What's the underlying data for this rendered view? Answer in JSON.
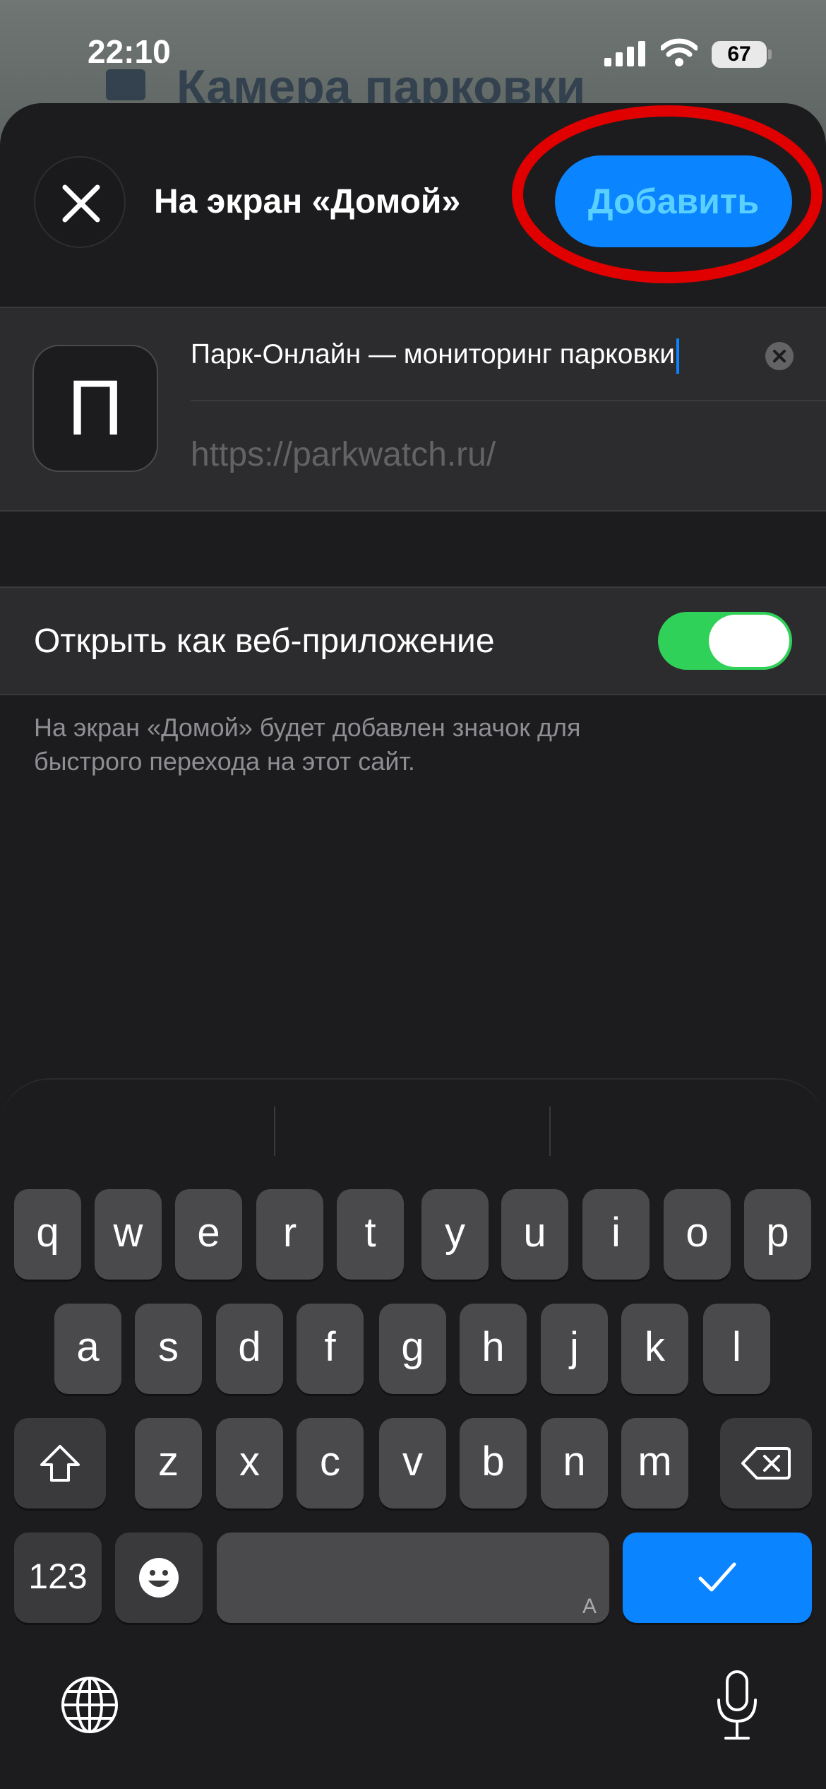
{
  "status_bar": {
    "time": "22:10",
    "battery": "67"
  },
  "background_page": {
    "title": "Камера парковки"
  },
  "header": {
    "title": "На экран «Домой»",
    "add_label": "Добавить"
  },
  "site": {
    "icon_letter": "П",
    "name_value": "Парк-Онлайн — мониторинг парковки",
    "url": "https://parkwatch.ru/"
  },
  "web_app": {
    "label": "Открыть как веб-приложение",
    "enabled": true,
    "hint": "На экран «Домой» будет добавлен значок для быстрого перехода на этот сайт."
  },
  "keyboard": {
    "row1": [
      "q",
      "w",
      "e",
      "r",
      "t",
      "y",
      "u",
      "i",
      "o",
      "p"
    ],
    "row2": [
      "a",
      "s",
      "d",
      "f",
      "g",
      "h",
      "j",
      "k",
      "l"
    ],
    "row3": [
      "z",
      "x",
      "c",
      "v",
      "b",
      "n",
      "m"
    ],
    "numbers_label": "123",
    "space_hint": "A"
  },
  "colors": {
    "accent": "#0a84ff",
    "toggle_on": "#30d158",
    "highlight": "#e00000"
  }
}
